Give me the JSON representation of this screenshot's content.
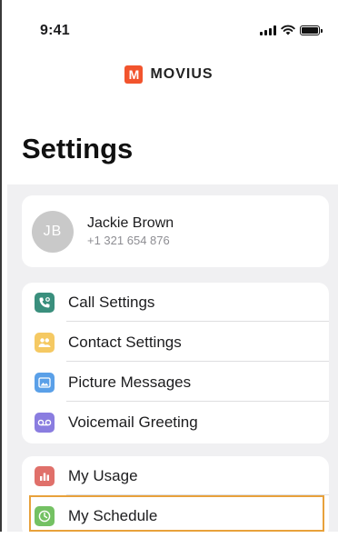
{
  "status_bar": {
    "time": "9:41"
  },
  "brand": {
    "logo_letter": "M",
    "name": "MOVIUS"
  },
  "page": {
    "title": "Settings"
  },
  "profile": {
    "initials": "JB",
    "name": "Jackie Brown",
    "phone": "+1 321 654 876"
  },
  "settings_group": [
    {
      "label": "Call Settings",
      "icon": "phone-gear-icon",
      "color": "#3a8f7d"
    },
    {
      "label": "Contact Settings",
      "icon": "contacts-icon",
      "color": "#f5c963"
    },
    {
      "label": "Picture Messages",
      "icon": "image-icon",
      "color": "#5aa0e8"
    },
    {
      "label": "Voicemail Greeting",
      "icon": "voicemail-icon",
      "color": "#8a7de0"
    }
  ],
  "usage_group": [
    {
      "label": "My Usage",
      "icon": "bar-chart-icon",
      "color": "#e0706a"
    },
    {
      "label": "My Schedule",
      "icon": "clock-icon",
      "color": "#74c163",
      "highlighted": true
    }
  ],
  "highlight_color": "#e8a13b"
}
